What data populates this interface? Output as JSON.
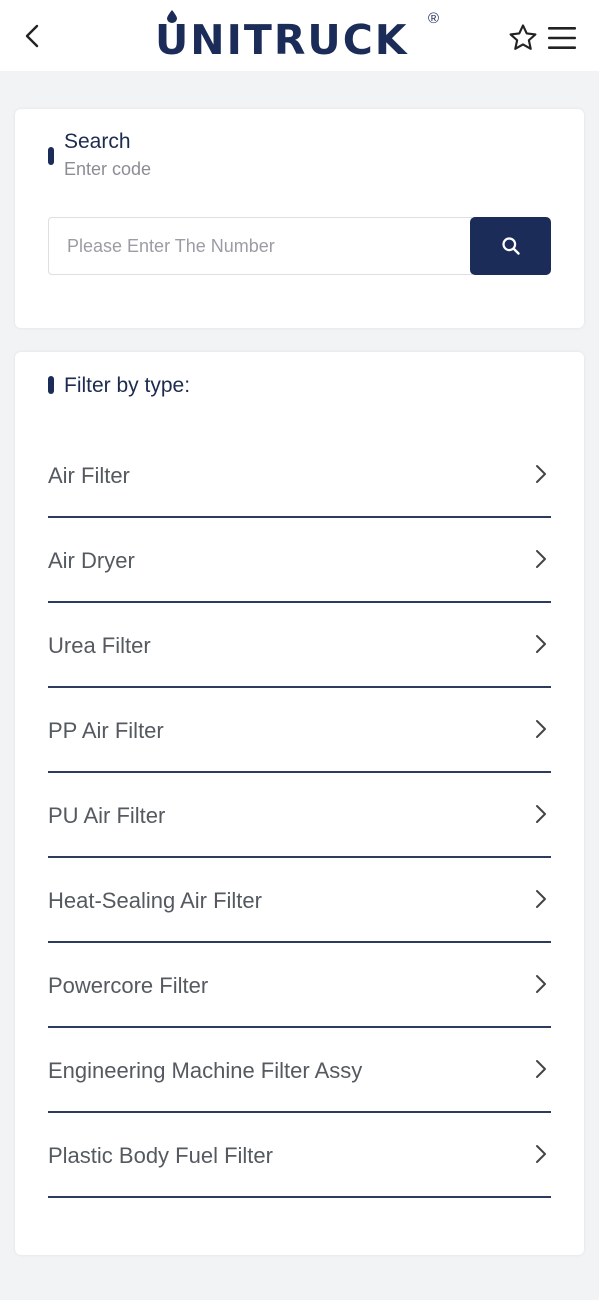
{
  "header": {
    "logo_text": "UNITRUCK",
    "logo_reg": "®"
  },
  "search": {
    "title": "Search",
    "subtitle": "Enter code",
    "placeholder": "Please Enter The Number",
    "value": ""
  },
  "filter": {
    "title": "Filter by type:",
    "items": [
      {
        "label": "Air Filter"
      },
      {
        "label": "Air Dryer"
      },
      {
        "label": "Urea Filter"
      },
      {
        "label": "PP Air Filter"
      },
      {
        "label": "PU Air Filter"
      },
      {
        "label": "Heat-Sealing Air Filter"
      },
      {
        "label": "Powercore Filter"
      },
      {
        "label": "Engineering Machine Filter Assy"
      },
      {
        "label": "Plastic Body Fuel Filter"
      }
    ]
  },
  "icons": {
    "back": "chevron-left-icon",
    "favorite": "star-outline-icon",
    "menu": "hamburger-menu-icon",
    "search": "search-icon",
    "item": "chevron-right-icon"
  },
  "colors": {
    "brand": "#1c2c58",
    "background": "#f1f3f5",
    "card": "#ffffff",
    "divider": "#2d3b5e"
  }
}
